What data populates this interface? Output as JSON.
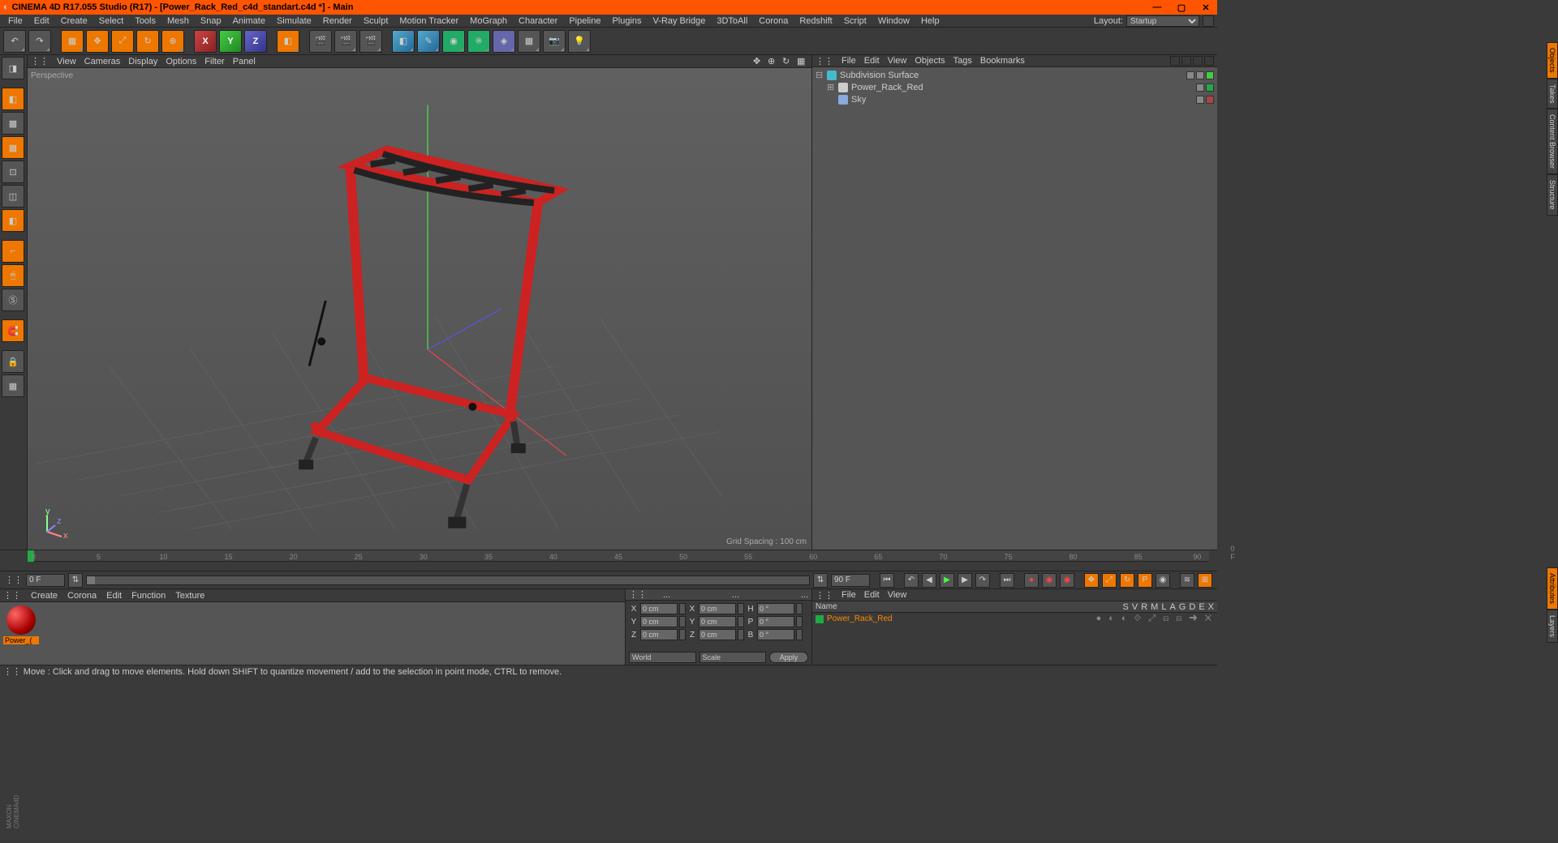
{
  "title": "CINEMA 4D R17.055 Studio (R17) - [Power_Rack_Red_c4d_standart.c4d *] - Main",
  "menus": [
    "File",
    "Edit",
    "Create",
    "Select",
    "Tools",
    "Mesh",
    "Snap",
    "Animate",
    "Simulate",
    "Render",
    "Sculpt",
    "Motion Tracker",
    "MoGraph",
    "Character",
    "Pipeline",
    "Plugins",
    "V-Ray Bridge",
    "3DToAll",
    "Corona",
    "Redshift",
    "Script",
    "Window",
    "Help"
  ],
  "layout_label": "Layout:",
  "layout_value": "Startup",
  "viewport_menus": [
    "View",
    "Cameras",
    "Display",
    "Options",
    "Filter",
    "Panel"
  ],
  "viewport_label": "Perspective",
  "grid_spacing": "Grid Spacing : 100 cm",
  "object_menus": [
    "File",
    "Edit",
    "View",
    "Objects",
    "Tags",
    "Bookmarks"
  ],
  "tree": [
    {
      "label": "Subdivision Surface",
      "lvl": 0,
      "expand": "⊟",
      "icon": "#4bc",
      "tags": [
        "#888",
        "#888",
        "#4c4"
      ]
    },
    {
      "label": "Power_Rack_Red",
      "lvl": 1,
      "expand": "⊞",
      "icon": "#ccc",
      "tags": [
        "#888",
        "#2a4"
      ]
    },
    {
      "label": "Sky",
      "lvl": 1,
      "expand": "",
      "icon": "#8ad",
      "tags": [
        "#888",
        "#a44"
      ]
    }
  ],
  "side_tabs_top": [
    "Objects",
    "Takes",
    "Content Browser",
    "Structure"
  ],
  "side_tabs_bottom": [
    "Attributes",
    "Layers"
  ],
  "timeline": {
    "start": 0,
    "end": 90,
    "step": 5,
    "frame_start": "0 F",
    "frame_end": "90 F",
    "range_start": "0 F",
    "range_end": "90 F"
  },
  "material_menus": [
    "Create",
    "Corona",
    "Edit",
    "Function",
    "Texture"
  ],
  "materials": [
    {
      "name": "Power_(",
      "color": "#c22"
    }
  ],
  "coord": {
    "tabs": [
      "≡",
      "...",
      "...",
      "..."
    ],
    "rows": [
      {
        "l": "X",
        "v1": "0 cm",
        "l2": "X",
        "v2": "0 cm",
        "l3": "H",
        "v3": "0 °"
      },
      {
        "l": "Y",
        "v1": "0 cm",
        "l2": "Y",
        "v2": "0 cm",
        "l3": "P",
        "v3": "0 °"
      },
      {
        "l": "Z",
        "v1": "0 cm",
        "l2": "Z",
        "v2": "0 cm",
        "l3": "B",
        "v3": "0 °"
      }
    ],
    "world": "World",
    "scale": "Scale",
    "apply": "Apply"
  },
  "attr_menus": [
    "File",
    "Edit",
    "View"
  ],
  "attr_name_hdr": "Name",
  "attr_cols": [
    "S",
    "V",
    "R",
    "M",
    "L",
    "A",
    "G",
    "D",
    "E",
    "X"
  ],
  "attr_item": "Power_Rack_Red",
  "status": "Move : Click and drag to move elements. Hold down SHIFT to quantize movement / add to the selection in point mode, CTRL to remove."
}
